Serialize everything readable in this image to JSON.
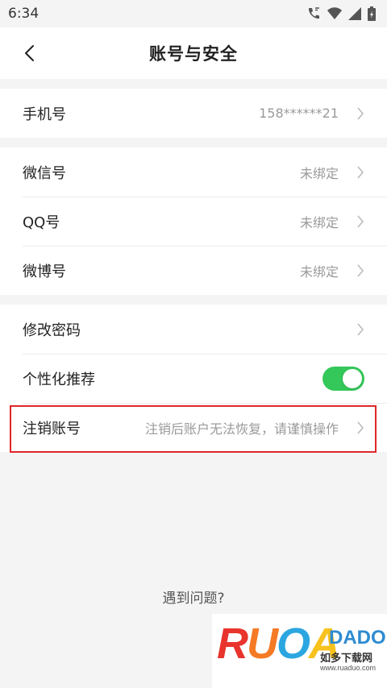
{
  "status_bar": {
    "time": "6:34"
  },
  "header": {
    "title": "账号与安全"
  },
  "phone_group": {
    "label": "手机号",
    "value": "158******21"
  },
  "social_group": [
    {
      "label": "微信号",
      "value": "未绑定"
    },
    {
      "label": "QQ号",
      "value": "未绑定"
    },
    {
      "label": "微博号",
      "value": "未绑定"
    }
  ],
  "security_group": {
    "change_password": "修改密码",
    "personalized_recommend": "个性化推荐",
    "personalized_recommend_on": true,
    "cancel_account": "注销账号",
    "cancel_account_hint": "注销后账户无法恢复，请谨慎操作"
  },
  "footer": {
    "help": "遇到问题?"
  },
  "watermark": {
    "brand_letters": "RUOA",
    "brand_rest": "DADO",
    "cn": "如多下载网",
    "url": "www.ruaduo.com"
  },
  "colors": {
    "toggle_on": "#34c759",
    "highlight": "#e0262b"
  }
}
